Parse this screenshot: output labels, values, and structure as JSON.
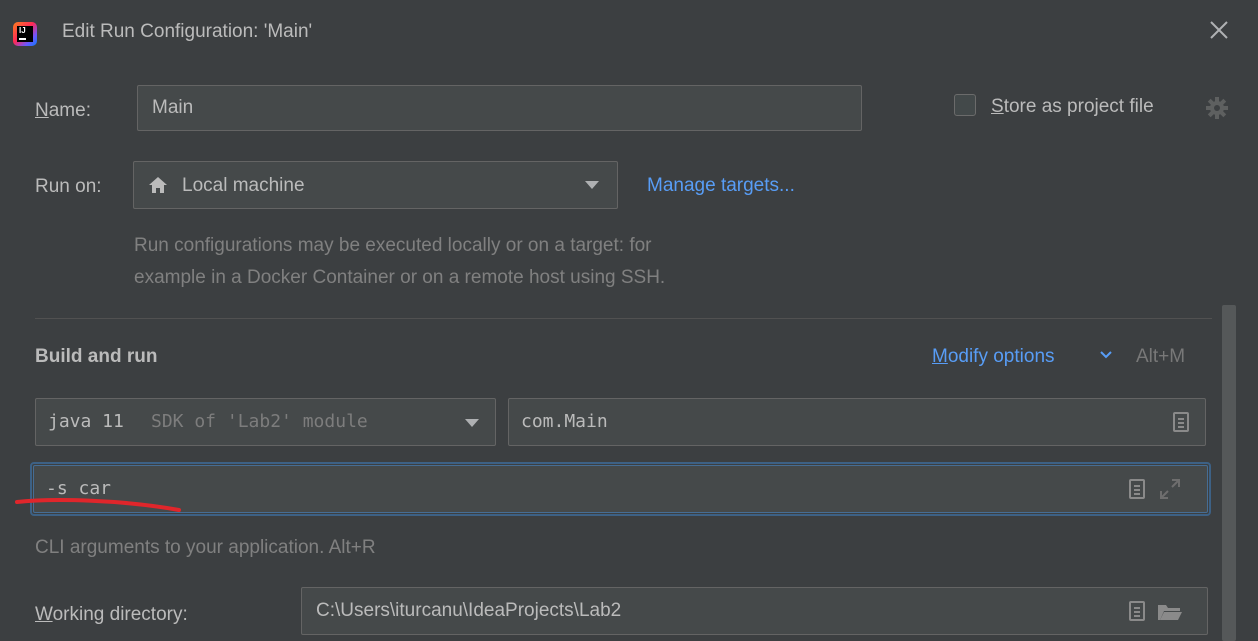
{
  "window": {
    "title": "Edit Run Configuration: 'Main'"
  },
  "name_row": {
    "label_underlined": "N",
    "label_rest": "ame:",
    "value": "Main"
  },
  "store": {
    "label_underlined": "S",
    "label_rest": "tore as project file",
    "checked": false
  },
  "run_on": {
    "label": "Run on:",
    "value": "Local machine",
    "manage_link": "Manage targets...",
    "hint_line1": "Run configurations may be executed locally or on a target: for",
    "hint_line2": "example in a Docker Container or on a remote host using SSH."
  },
  "build": {
    "section_title": "Build and run",
    "modify_underlined": "M",
    "modify_rest": "odify options",
    "modify_shortcut": "Alt+M",
    "sdk_bold": "java 11",
    "sdk_rest": "SDK of 'Lab2' module",
    "main_class": "com.Main",
    "program_args": "-s car",
    "args_hint": "CLI arguments to your application. Alt+R"
  },
  "workdir": {
    "label_underlined": "W",
    "label_rest": "orking directory:",
    "value": "C:\\Users\\iturcanu\\IdeaProjects\\Lab2"
  },
  "colors": {
    "background": "#3c3f41",
    "field": "#45494a",
    "focus_border": "#3d6185",
    "link": "#589df6",
    "annotation": "#e0262b"
  }
}
